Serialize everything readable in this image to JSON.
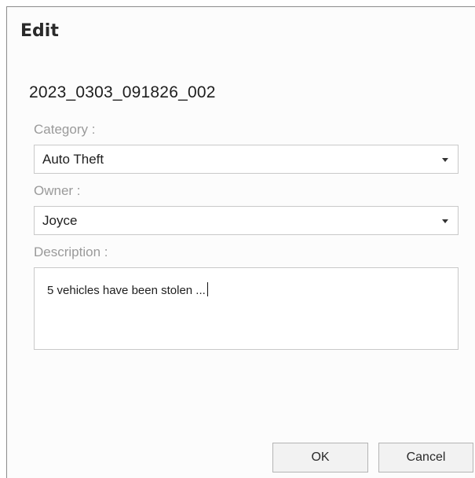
{
  "dialog": {
    "title": "Edit",
    "record_id": "2023_0303_091826_002"
  },
  "form": {
    "category": {
      "label": "Category :",
      "value": "Auto Theft"
    },
    "owner": {
      "label": "Owner :",
      "value": "Joyce"
    },
    "description": {
      "label": "Description :",
      "value": "5 vehicles have been stolen ..."
    }
  },
  "buttons": {
    "ok_label": "OK",
    "cancel_label": "Cancel"
  }
}
